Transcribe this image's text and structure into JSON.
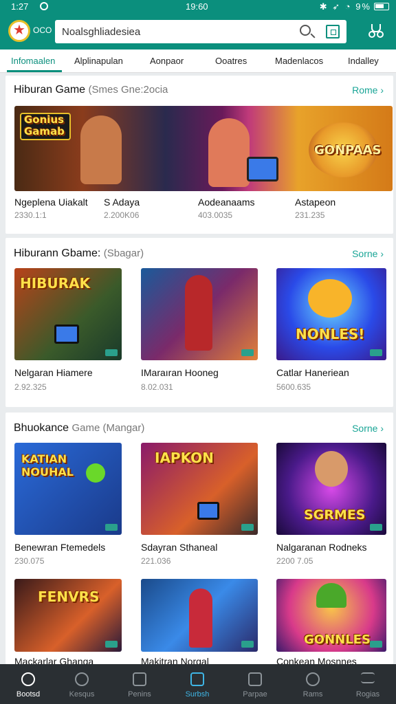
{
  "status": {
    "time": "1:27",
    "center": "19:60",
    "right": "✱ ➶ ◔ 9%"
  },
  "header": {
    "app_name": "OCO",
    "search_value": "Noalsghliadesiea"
  },
  "tabs": [
    "Infomaalen",
    "Alplinapulan",
    "Aonpaor",
    "Ooatres",
    "Madenlacos",
    "Indalley"
  ],
  "sections": [
    {
      "title": "Hiburan Game",
      "subtitle": "(Smes Gne:2ocia",
      "more": "Rome ›",
      "banner_left_text": "Gonius Gamab",
      "banner_right_text": "GONPAAS",
      "cards": [
        {
          "title": "Ngeplena Uiakalt",
          "meta": "2330.1:1"
        },
        {
          "title": "S Adaya",
          "meta": "2.200K06"
        },
        {
          "title": "Aodeanaams",
          "meta": "403.0035"
        },
        {
          "title": "Astapeon",
          "meta": "231.235"
        }
      ]
    },
    {
      "title": "Hiburann Gbame:",
      "subtitle": "(Sbagar)",
      "more": "Sorne ›",
      "cards": [
        {
          "title": "Nelgaran Hiamere",
          "meta": "2.92.325",
          "art": "HIBURAK"
        },
        {
          "title": "IMaraıran Hooneg",
          "meta": "8.02.031",
          "art": ""
        },
        {
          "title": "Catlar Haneriean",
          "meta": "5600.635",
          "art": "NONLES!"
        }
      ]
    },
    {
      "title": "Bhuokance",
      "subtitle": "Game (Mangar)",
      "more": "Sorne ›",
      "cards": [
        {
          "title": "Benewran Ftemedels",
          "meta": "230.075",
          "art": "KATIAN NOUHAL"
        },
        {
          "title": "Sdayran Sthaneal",
          "meta": "221.036",
          "art": "IAPKON"
        },
        {
          "title": "Nalgaranan Rodneks",
          "meta": "2200 7.05",
          "art": "SGRMES"
        },
        {
          "title": "Mackarlar Ghanga",
          "meta": "",
          "art": "FENVRS"
        },
        {
          "title": "Makitran Norgal",
          "meta": "",
          "art": ""
        },
        {
          "title": "Conkean Mosnnes",
          "meta": "",
          "art": "GONNLES"
        }
      ]
    }
  ],
  "bottom_nav": [
    "Bootsd",
    "Kesqus",
    "Penins",
    "Surbsh",
    "Parpae",
    "Rams",
    "Rogias"
  ]
}
